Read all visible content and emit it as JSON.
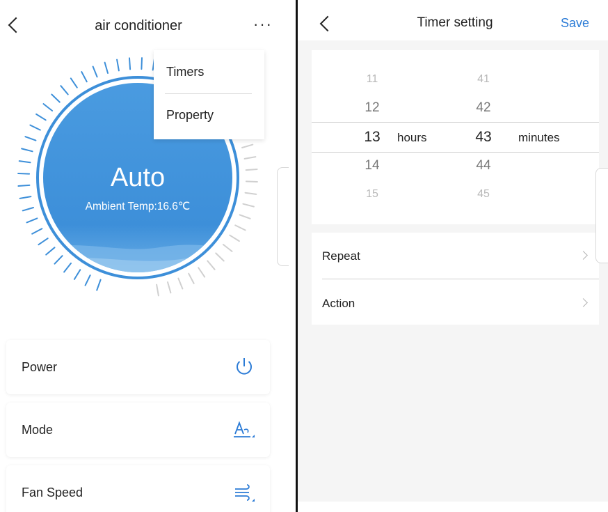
{
  "left": {
    "title": "air conditioner",
    "more_label": "···",
    "dial": {
      "mode": "Auto",
      "ambient": "Ambient Temp:16.6℃"
    },
    "menu": [
      {
        "label": "Timers"
      },
      {
        "label": "Property"
      }
    ],
    "controls": [
      {
        "label": "Power",
        "icon": "power-icon"
      },
      {
        "label": "Mode",
        "icon": "mode-a-icon"
      },
      {
        "label": "Fan Speed",
        "icon": "wind-icon"
      }
    ]
  },
  "right": {
    "title": "Timer setting",
    "save": "Save",
    "picker": {
      "hours": [
        "11",
        "12",
        "13",
        "14",
        "15"
      ],
      "minutes": [
        "41",
        "42",
        "43",
        "44",
        "45"
      ],
      "hours_unit": "hours",
      "minutes_unit": "minutes"
    },
    "rows": [
      {
        "label": "Repeat"
      },
      {
        "label": "Action"
      }
    ]
  },
  "colors": {
    "accent": "#2b7bd6",
    "dial_blue": "#3d8fd9",
    "tick_gray": "#d0d0d0"
  }
}
